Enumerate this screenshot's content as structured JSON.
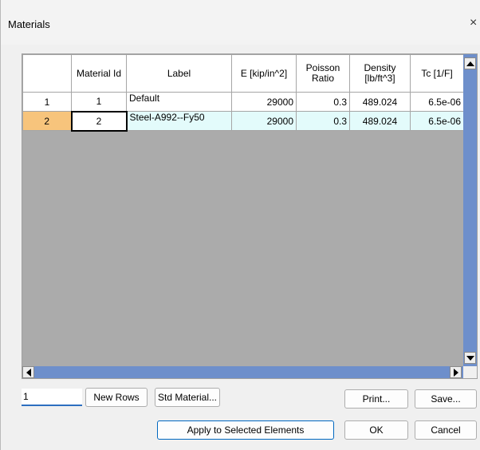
{
  "window": {
    "title": "Materials",
    "close_glyph": "×"
  },
  "table": {
    "columns": [
      "Material Id",
      "Label",
      "E [kip/in^2]",
      "Poisson Ratio",
      "Density [lb/ft^3]",
      "Tc [1/F]"
    ],
    "rows": [
      {
        "rownum": "1",
        "id": "1",
        "label": "Default",
        "e": "29000",
        "poisson": "0.3",
        "density": "489.024",
        "tc": "6.5e-06"
      },
      {
        "rownum": "2",
        "id": "2",
        "label": "Steel-A992--Fy50",
        "e": "29000",
        "poisson": "0.3",
        "density": "489.024",
        "tc": "6.5e-06"
      }
    ],
    "selected_row": 2
  },
  "controls": {
    "row_count_value": "1",
    "new_rows": "New Rows",
    "std_material": "Std Material...",
    "print": "Print...",
    "save": "Save...",
    "apply": "Apply to Selected Elements",
    "ok": "OK",
    "cancel": "Cancel"
  },
  "colors": {
    "selected_header": "#f7c47c",
    "selected_row_bg": "#e3fbfb",
    "scrollbar": "#6e8fcb",
    "grid_empty_bg": "#ababab"
  }
}
